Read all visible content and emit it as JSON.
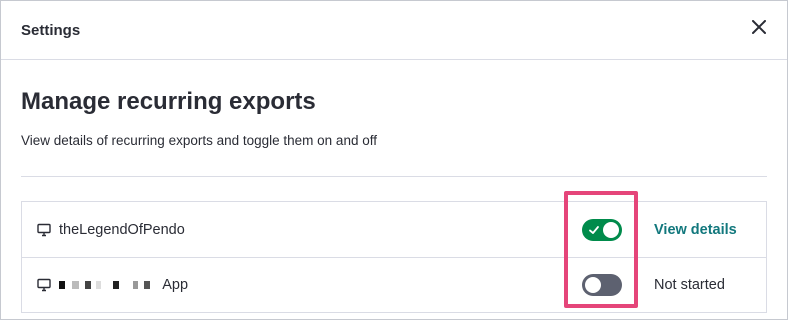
{
  "header": {
    "title": "Settings"
  },
  "page": {
    "title": "Manage recurring exports",
    "description": "View details of recurring exports and toggle them on and off"
  },
  "exports": [
    {
      "name": "theLegendOfPendo",
      "enabled": true,
      "action": "View details"
    },
    {
      "name": "App",
      "enabled": false,
      "status": "Not started"
    }
  ],
  "icons": {
    "close": "close-icon",
    "app": "desktop-icon",
    "check": "check-icon"
  },
  "colors": {
    "toggle_on": "#008b4b",
    "toggle_off": "#5d6170",
    "link": "#12787d",
    "highlight": "#e5457a"
  }
}
